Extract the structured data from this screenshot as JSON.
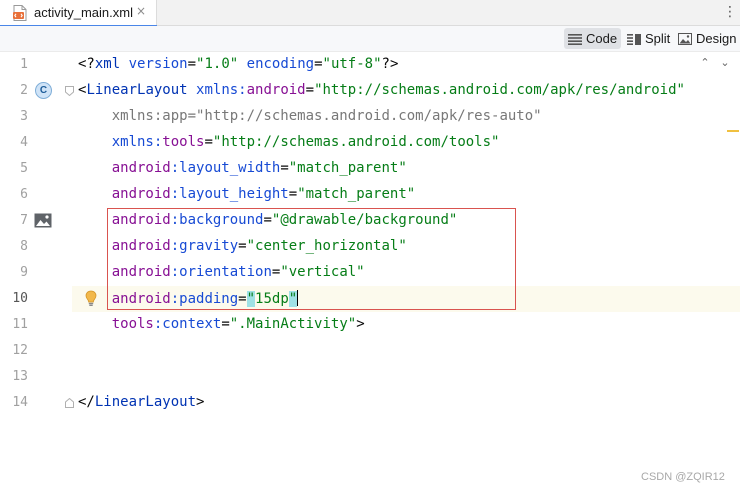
{
  "tab": {
    "file_name": "activity_main.xml",
    "close_glyph": "×"
  },
  "menu": {
    "kebab_glyph": "⋮"
  },
  "view_modes": [
    {
      "label": "Code",
      "icon": "code-lines-icon",
      "active": true
    },
    {
      "label": "Split",
      "icon": "split-view-icon",
      "active": false
    },
    {
      "label": "Design",
      "icon": "image-icon",
      "active": false
    }
  ],
  "inspection": {
    "warning_count": "1",
    "prev_glyph": "⌃",
    "next_glyph": "⌄"
  },
  "editor": {
    "current_line": 10,
    "lines": [
      {
        "num": "1",
        "text": "<?xml version=\"1.0\" encoding=\"utf-8\"?>"
      },
      {
        "num": "2",
        "text": "<LinearLayout xmlns:android=\"http://schemas.android.com/apk/res/android\""
      },
      {
        "num": "3",
        "text": "    xmlns:app=\"http://schemas.android.com/apk/res-auto\""
      },
      {
        "num": "4",
        "text": "    xmlns:tools=\"http://schemas.android.com/tools\""
      },
      {
        "num": "5",
        "text": "    android:layout_width=\"match_parent\""
      },
      {
        "num": "6",
        "text": "    android:layout_height=\"match_parent\""
      },
      {
        "num": "7",
        "text": "    android:background=\"@drawable/background\""
      },
      {
        "num": "8",
        "text": "    android:gravity=\"center_horizontal\""
      },
      {
        "num": "9",
        "text": "    android:orientation=\"vertical\""
      },
      {
        "num": "10",
        "text": "    android:padding=\"15dp\""
      },
      {
        "num": "11",
        "text": "    tools:context=\".MainActivity\">"
      },
      {
        "num": "12",
        "text": ""
      },
      {
        "num": "13",
        "text": ""
      },
      {
        "num": "14",
        "text": "</LinearLayout>"
      }
    ],
    "gutter_badge": "C"
  },
  "colors": {
    "tag": "#0033b3",
    "namespace": "#871094",
    "attribute": "#174ad4",
    "value": "#067d17",
    "muted": "#787878",
    "selection_box": "#d9534f",
    "current_line_bg": "#fcfaed",
    "quote_highlight": "#9fe1e5"
  },
  "watermark": "CSDN @ZQIR12"
}
